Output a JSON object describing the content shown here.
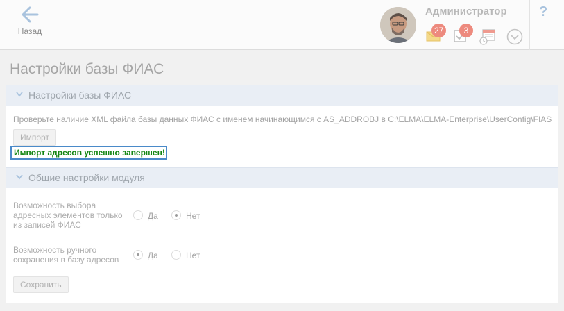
{
  "header": {
    "back_label": "Назад",
    "user_name": "Администратор",
    "messages_count": "27",
    "tasks_count": "3",
    "help_label": "?"
  },
  "page": {
    "title": "Настройки базы ФИАС"
  },
  "fias_section": {
    "title": "Настройки базы ФИАС",
    "info_text": "Проверьте наличие XML файла базы данных ФИАС с именем начинающимся с AS_ADDROBJ в C:\\ELMA\\ELMA-Enterprise\\UserConfig\\FIAS",
    "import_button": "Импорт",
    "success_message": "Импорт адресов успешно завершен!"
  },
  "module_section": {
    "title": "Общие настройки модуля",
    "settings": [
      {
        "label": "Возможность выбора адресных элементов только из записей ФИАС",
        "yes": "Да",
        "no": "Нет",
        "selected": "no"
      },
      {
        "label": "Возможность ручного сохранения в базу адресов",
        "yes": "Да",
        "no": "Нет",
        "selected": "yes"
      }
    ],
    "save_button": "Сохранить"
  },
  "colors": {
    "accent": "#4a8ac9",
    "badge": "#ed8a7e",
    "section_bar": "#e9eef5",
    "success_text": "#128512"
  }
}
